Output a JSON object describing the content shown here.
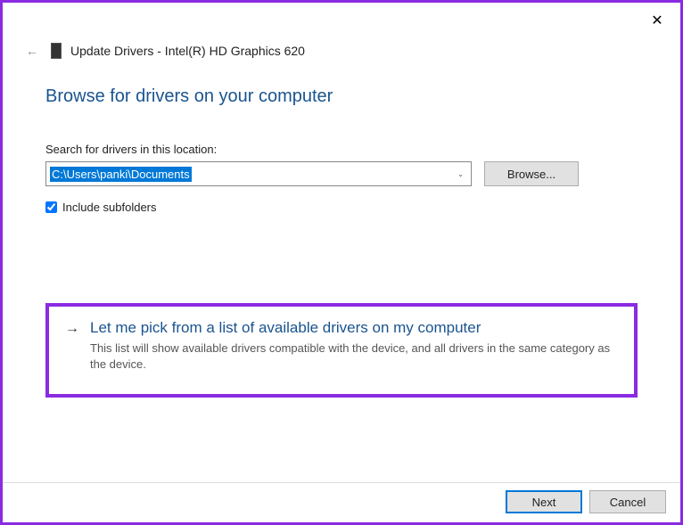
{
  "window": {
    "close_glyph": "✕"
  },
  "header": {
    "back_glyph": "←",
    "title": "Update Drivers - Intel(R) HD Graphics 620"
  },
  "main": {
    "heading": "Browse for drivers on your computer",
    "search_label": "Search for drivers in this location:",
    "path_value": "C:\\Users\\panki\\Documents",
    "combo_arrow": "⌄",
    "browse_label": "Browse...",
    "include_subfolders_checked": true,
    "include_subfolders_label": "Include subfolders"
  },
  "option": {
    "arrow_glyph": "→",
    "title": "Let me pick from a list of available drivers on my computer",
    "description": "This list will show available drivers compatible with the device, and all drivers in the same category as the device."
  },
  "footer": {
    "next_label": "Next",
    "cancel_label": "Cancel"
  }
}
